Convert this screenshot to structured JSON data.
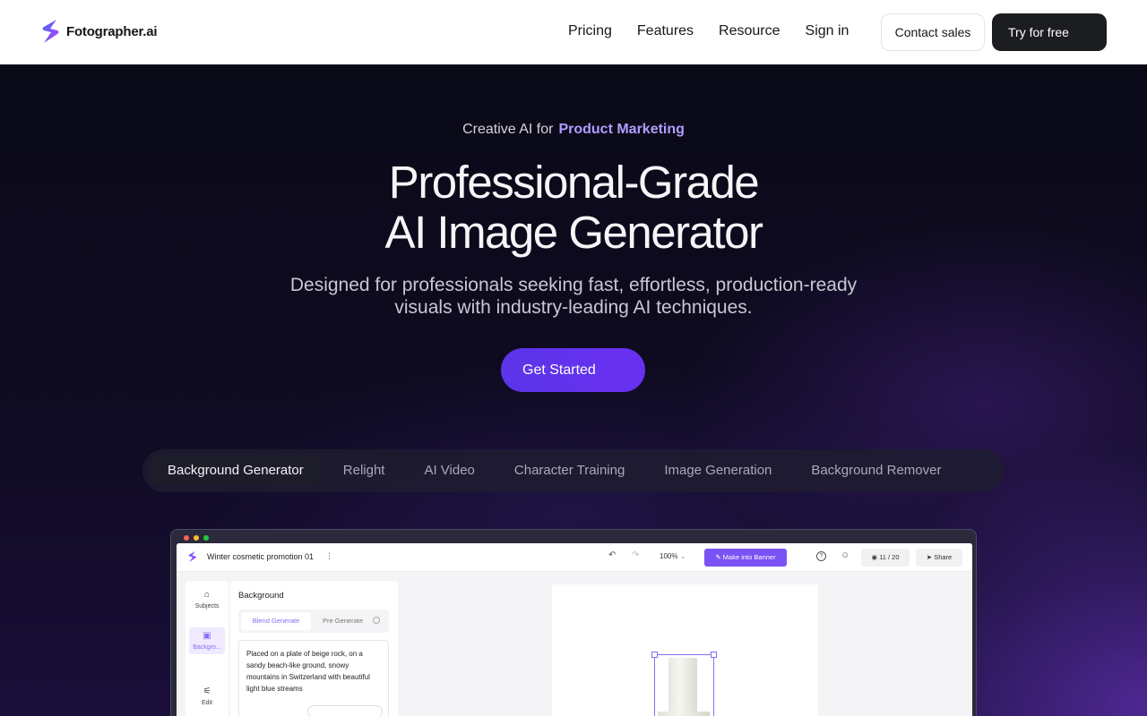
{
  "nav": {
    "brand": "Fotographer.ai",
    "links": [
      "Pricing",
      "Features",
      "Resource",
      "Sign in"
    ],
    "contact_label": "Contact sales",
    "try_label": "Try for free"
  },
  "hero": {
    "eyebrow_prefix": "Creative AI for",
    "eyebrow_accent": "Product Marketing",
    "headline_line1": "Professional-Grade",
    "headline_line2": "AI Image Generator",
    "subhead": "Designed for professionals seeking fast, effortless, production-ready visuals with industry-leading AI techniques.",
    "cta_label": "Get Started"
  },
  "tabs": [
    "Background Generator",
    "Relight",
    "AI Video",
    "Character Training",
    "Image Generation",
    "Background Remover"
  ],
  "mockup": {
    "project_title": "Winter cosmetic promotion 01",
    "zoom": "100%",
    "banner_label": "Make into Banner",
    "credits": "11 / 20",
    "share_label": "Share",
    "sidebar": [
      "Subjects",
      "Backgro...",
      "Edit"
    ],
    "panel_title": "Background",
    "seg_active": "Blend Generate",
    "seg_inactive": "Pre Generate",
    "prompt_text": "Placed on a plate of beige rock, on a sandy beach-like ground, snowy mountains in Switzerland with beautiful light blue streams"
  },
  "colors": {
    "accent": "#b19cff",
    "cta": "#5b35e8",
    "banner_button": "#7b52f4",
    "window_dots": [
      "#ff5f57",
      "#febc2e",
      "#28c840"
    ]
  }
}
